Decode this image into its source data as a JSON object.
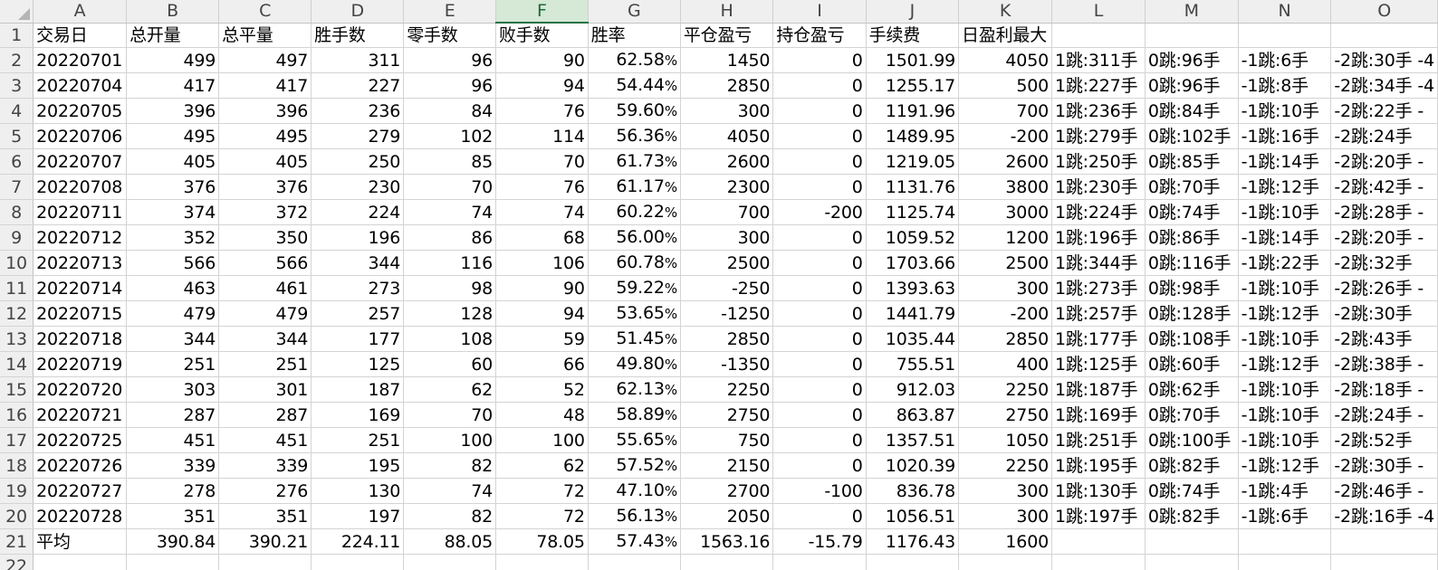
{
  "columns": [
    "A",
    "B",
    "C",
    "D",
    "E",
    "F",
    "G",
    "H",
    "I",
    "J",
    "K",
    "L",
    "M",
    "N",
    "O"
  ],
  "active_column": "F",
  "rows": [
    {
      "row": "1",
      "A": "交易日",
      "B": "总开量",
      "C": "总平量",
      "D": "胜手数",
      "E": "零手数",
      "F": "败手数",
      "G": "胜率",
      "H": "平仓盈亏",
      "I": "持仓盈亏",
      "J": "手续费",
      "K": "日盈利最大",
      "L": "",
      "M": "",
      "N": "",
      "O": ""
    },
    {
      "row": "2",
      "A": "20220701",
      "B": "499",
      "C": "497",
      "D": "311",
      "E": "96",
      "F": "90",
      "G": "62.58",
      "H": "1450",
      "I": "0",
      "J": "1501.99",
      "K": "4050",
      "L": "1跳:311手",
      "M": "0跳:96手",
      "N": "-1跳:6手",
      "O": "-2跳:30手 -4"
    },
    {
      "row": "3",
      "A": "20220704",
      "B": "417",
      "C": "417",
      "D": "227",
      "E": "96",
      "F": "94",
      "G": "54.44",
      "H": "2850",
      "I": "0",
      "J": "1255.17",
      "K": "500",
      "L": "1跳:227手",
      "M": "0跳:96手",
      "N": "-1跳:8手",
      "O": "-2跳:34手 -4"
    },
    {
      "row": "4",
      "A": "20220705",
      "B": "396",
      "C": "396",
      "D": "236",
      "E": "84",
      "F": "76",
      "G": "59.60",
      "H": "300",
      "I": "0",
      "J": "1191.96",
      "K": "700",
      "L": "1跳:236手",
      "M": "0跳:84手",
      "N": "-1跳:10手",
      "O": "-2跳:22手 -"
    },
    {
      "row": "5",
      "A": "20220706",
      "B": "495",
      "C": "495",
      "D": "279",
      "E": "102",
      "F": "114",
      "G": "56.36",
      "H": "4050",
      "I": "0",
      "J": "1489.95",
      "K": "-200",
      "L": "1跳:279手",
      "M": "0跳:102手",
      "N": "-1跳:16手",
      "O": "-2跳:24手"
    },
    {
      "row": "6",
      "A": "20220707",
      "B": "405",
      "C": "405",
      "D": "250",
      "E": "85",
      "F": "70",
      "G": "61.73",
      "H": "2600",
      "I": "0",
      "J": "1219.05",
      "K": "2600",
      "L": "1跳:250手",
      "M": "0跳:85手",
      "N": "-1跳:14手",
      "O": "-2跳:20手 -"
    },
    {
      "row": "7",
      "A": "20220708",
      "B": "376",
      "C": "376",
      "D": "230",
      "E": "70",
      "F": "76",
      "G": "61.17",
      "H": "2300",
      "I": "0",
      "J": "1131.76",
      "K": "3800",
      "L": "1跳:230手",
      "M": "0跳:70手",
      "N": "-1跳:12手",
      "O": "-2跳:42手 -"
    },
    {
      "row": "8",
      "A": "20220711",
      "B": "374",
      "C": "372",
      "D": "224",
      "E": "74",
      "F": "74",
      "G": "60.22",
      "H": "700",
      "I": "-200",
      "J": "1125.74",
      "K": "3000",
      "L": "1跳:224手",
      "M": "0跳:74手",
      "N": "-1跳:10手",
      "O": "-2跳:28手 -"
    },
    {
      "row": "9",
      "A": "20220712",
      "B": "352",
      "C": "350",
      "D": "196",
      "E": "86",
      "F": "68",
      "G": "56.00",
      "H": "300",
      "I": "0",
      "J": "1059.52",
      "K": "1200",
      "L": "1跳:196手",
      "M": "0跳:86手",
      "N": "-1跳:14手",
      "O": "-2跳:20手 -"
    },
    {
      "row": "10",
      "A": "20220713",
      "B": "566",
      "C": "566",
      "D": "344",
      "E": "116",
      "F": "106",
      "G": "60.78",
      "H": "2500",
      "I": "0",
      "J": "1703.66",
      "K": "2500",
      "L": "1跳:344手",
      "M": "0跳:116手",
      "N": "-1跳:22手",
      "O": "-2跳:32手"
    },
    {
      "row": "11",
      "A": "20220714",
      "B": "463",
      "C": "461",
      "D": "273",
      "E": "98",
      "F": "90",
      "G": "59.22",
      "H": "-250",
      "I": "0",
      "J": "1393.63",
      "K": "300",
      "L": "1跳:273手",
      "M": "0跳:98手",
      "N": "-1跳:10手",
      "O": "-2跳:26手 -"
    },
    {
      "row": "12",
      "A": "20220715",
      "B": "479",
      "C": "479",
      "D": "257",
      "E": "128",
      "F": "94",
      "G": "53.65",
      "H": "-1250",
      "I": "0",
      "J": "1441.79",
      "K": "-200",
      "L": "1跳:257手",
      "M": "0跳:128手",
      "N": "-1跳:12手",
      "O": "-2跳:30手"
    },
    {
      "row": "13",
      "A": "20220718",
      "B": "344",
      "C": "344",
      "D": "177",
      "E": "108",
      "F": "59",
      "G": "51.45",
      "H": "2850",
      "I": "0",
      "J": "1035.44",
      "K": "2850",
      "L": "1跳:177手",
      "M": "0跳:108手",
      "N": "-1跳:10手",
      "O": "-2跳:43手"
    },
    {
      "row": "14",
      "A": "20220719",
      "B": "251",
      "C": "251",
      "D": "125",
      "E": "60",
      "F": "66",
      "G": "49.80",
      "H": "-1350",
      "I": "0",
      "J": "755.51",
      "K": "400",
      "L": "1跳:125手",
      "M": "0跳:60手",
      "N": "-1跳:12手",
      "O": "-2跳:38手 -"
    },
    {
      "row": "15",
      "A": "20220720",
      "B": "303",
      "C": "301",
      "D": "187",
      "E": "62",
      "F": "52",
      "G": "62.13",
      "H": "2250",
      "I": "0",
      "J": "912.03",
      "K": "2250",
      "L": "1跳:187手",
      "M": "0跳:62手",
      "N": "-1跳:10手",
      "O": "-2跳:18手 -"
    },
    {
      "row": "16",
      "A": "20220721",
      "B": "287",
      "C": "287",
      "D": "169",
      "E": "70",
      "F": "48",
      "G": "58.89",
      "H": "2750",
      "I": "0",
      "J": "863.87",
      "K": "2750",
      "L": "1跳:169手",
      "M": "0跳:70手",
      "N": "-1跳:10手",
      "O": "-2跳:24手 -"
    },
    {
      "row": "17",
      "A": "20220725",
      "B": "451",
      "C": "451",
      "D": "251",
      "E": "100",
      "F": "100",
      "G": "55.65",
      "H": "750",
      "I": "0",
      "J": "1357.51",
      "K": "1050",
      "L": "1跳:251手",
      "M": "0跳:100手",
      "N": "-1跳:10手",
      "O": "-2跳:52手"
    },
    {
      "row": "18",
      "A": "20220726",
      "B": "339",
      "C": "339",
      "D": "195",
      "E": "82",
      "F": "62",
      "G": "57.52",
      "H": "2150",
      "I": "0",
      "J": "1020.39",
      "K": "2250",
      "L": "1跳:195手",
      "M": "0跳:82手",
      "N": "-1跳:12手",
      "O": "-2跳:30手 -"
    },
    {
      "row": "19",
      "A": "20220727",
      "B": "278",
      "C": "276",
      "D": "130",
      "E": "74",
      "F": "72",
      "G": "47.10",
      "H": "2700",
      "I": "-100",
      "J": "836.78",
      "K": "300",
      "L": "1跳:130手",
      "M": "0跳:74手",
      "N": "-1跳:4手",
      "O": "-2跳:46手 -"
    },
    {
      "row": "20",
      "A": "20220728",
      "B": "351",
      "C": "351",
      "D": "197",
      "E": "82",
      "F": "72",
      "G": "56.13",
      "H": "2050",
      "I": "0",
      "J": "1056.51",
      "K": "300",
      "L": "1跳:197手",
      "M": "0跳:82手",
      "N": "-1跳:6手",
      "O": "-2跳:16手 -4"
    },
    {
      "row": "21",
      "A": "平均",
      "B": "390.84",
      "C": "390.21",
      "D": "224.11",
      "E": "88.05",
      "F": "78.05",
      "G": "57.43",
      "H": "1563.16",
      "I": "-15.79",
      "J": "1176.43",
      "K": "1600",
      "L": "",
      "M": "",
      "N": "",
      "O": ""
    },
    {
      "row": "22",
      "A": "",
      "B": "",
      "C": "",
      "D": "",
      "E": "",
      "F": "",
      "G": "",
      "H": "",
      "I": "",
      "J": "",
      "K": "",
      "L": "",
      "M": "",
      "N": "",
      "O": ""
    }
  ],
  "percent_sign": "%",
  "colors": {
    "grid": "#d4d4d4",
    "header_bg": "#efefef",
    "active_header_bg": "#d6e8d6",
    "active_header_text": "#1e6b35"
  }
}
